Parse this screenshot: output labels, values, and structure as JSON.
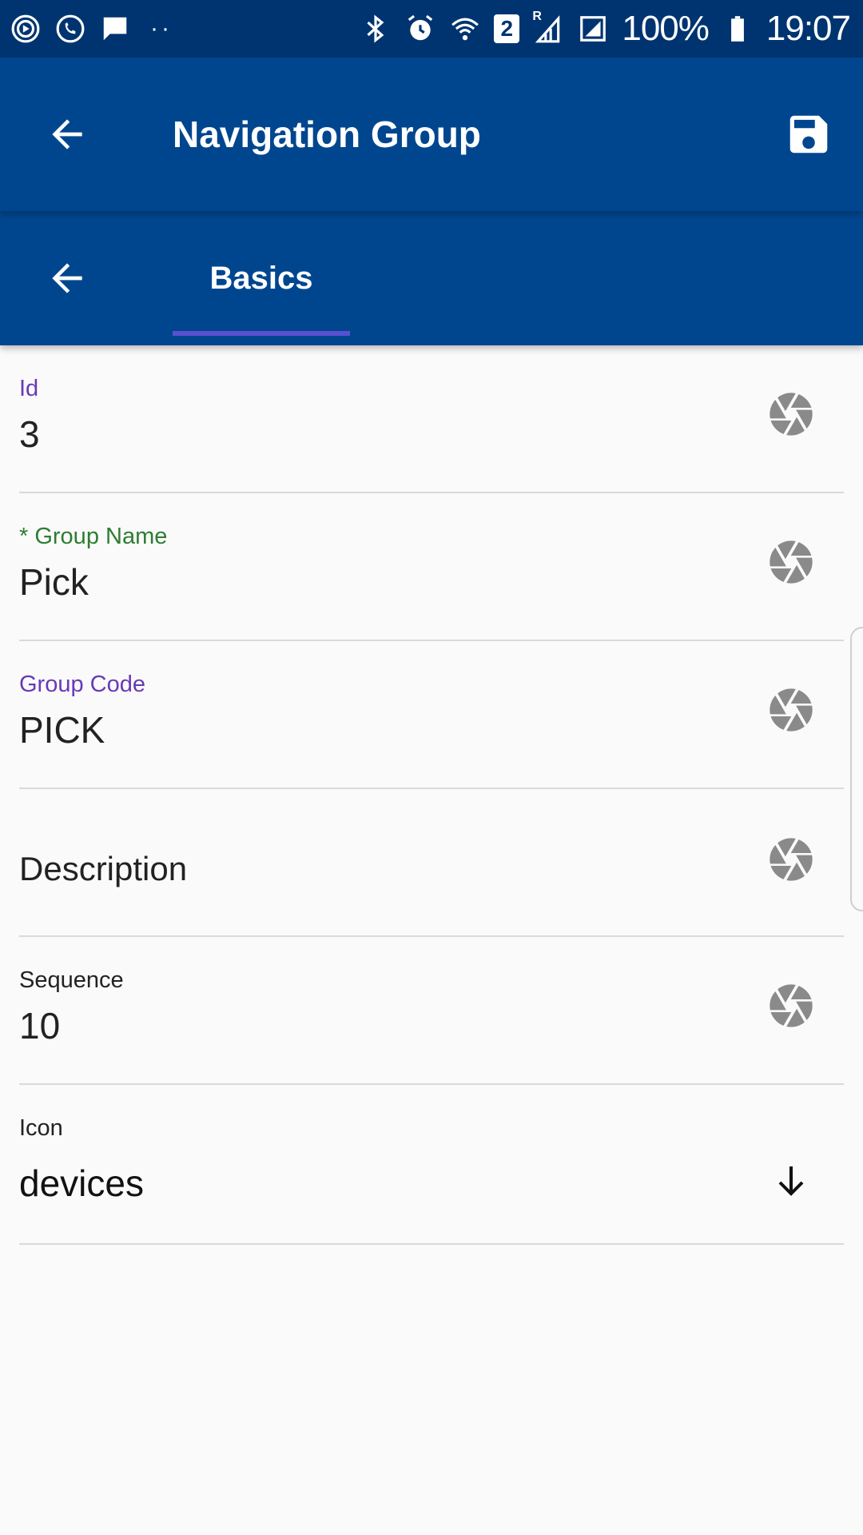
{
  "status_bar": {
    "battery": "100%",
    "time": "19:07",
    "sim_badge": "2",
    "roaming": "R"
  },
  "app_bar": {
    "title": "Navigation Group"
  },
  "tabs": [
    {
      "label": "Basics",
      "active": true
    }
  ],
  "form": {
    "fields": [
      {
        "label": "Id",
        "value": "3",
        "label_color": "#673ab7"
      },
      {
        "label": "* Group Name",
        "value": "Pick",
        "label_color": "#2e7d32"
      },
      {
        "label": "Group Code",
        "value": "PICK",
        "label_color": "#673ab7"
      },
      {
        "label": "Description",
        "value": ""
      },
      {
        "label": "Sequence",
        "value": "10",
        "label_color": "#222222"
      },
      {
        "label": "Icon",
        "value": "devices",
        "label_color": "#222222"
      }
    ]
  },
  "colors": {
    "status_bar_bg": "#003470",
    "app_bar_bg": "#00468f",
    "tab_indicator": "#5a4fd0",
    "icon_gray": "#8a8a8a"
  }
}
